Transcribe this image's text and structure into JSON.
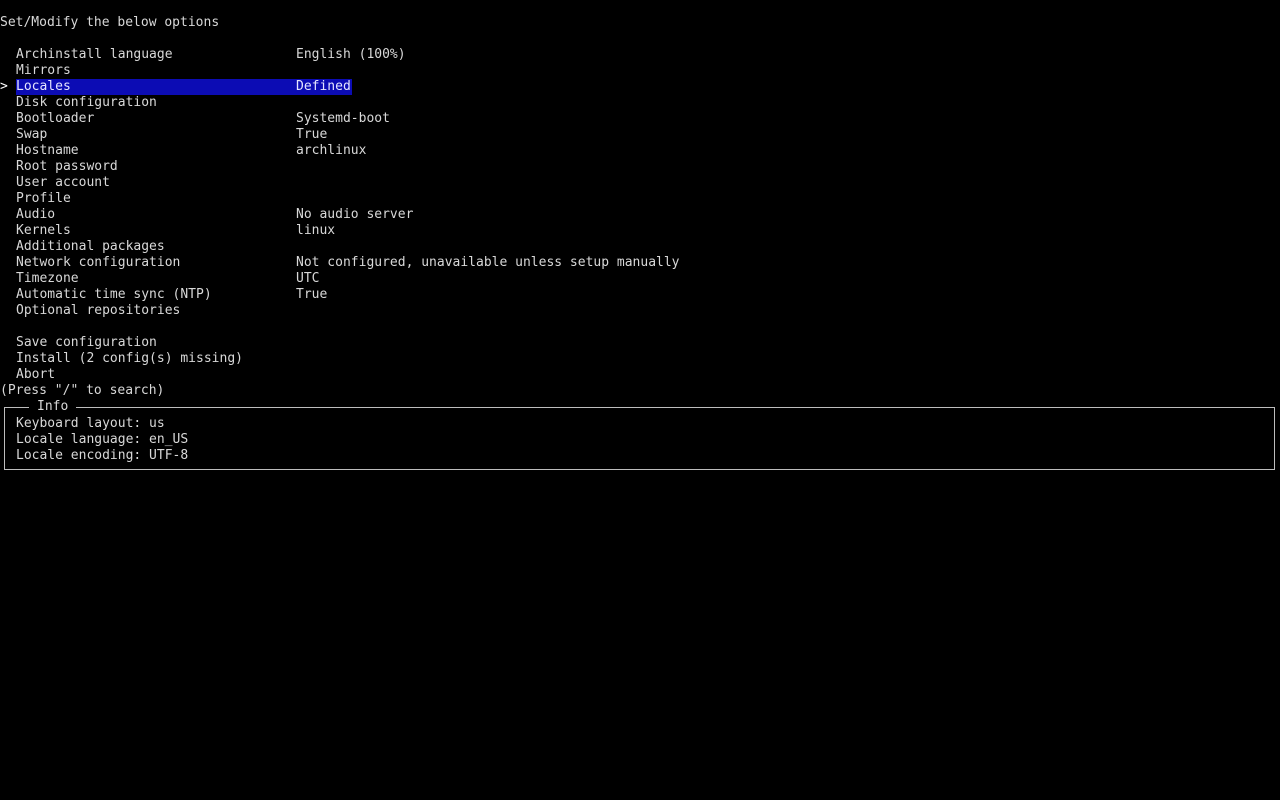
{
  "header": "Set/Modify the below options",
  "cursor_symbol": ">",
  "selected_index": 2,
  "menu": [
    {
      "label": "Archinstall language",
      "value": "English (100%)"
    },
    {
      "label": "Mirrors",
      "value": ""
    },
    {
      "label": "Locales",
      "value": "Defined"
    },
    {
      "label": "Disk configuration",
      "value": ""
    },
    {
      "label": "Bootloader",
      "value": "Systemd-boot"
    },
    {
      "label": "Swap",
      "value": "True"
    },
    {
      "label": "Hostname",
      "value": "archlinux"
    },
    {
      "label": "Root password",
      "value": ""
    },
    {
      "label": "User account",
      "value": ""
    },
    {
      "label": "Profile",
      "value": ""
    },
    {
      "label": "Audio",
      "value": "No audio server"
    },
    {
      "label": "Kernels",
      "value": "linux"
    },
    {
      "label": "Additional packages",
      "value": ""
    },
    {
      "label": "Network configuration",
      "value": "Not configured, unavailable unless setup manually"
    },
    {
      "label": "Timezone",
      "value": "UTC"
    },
    {
      "label": "Automatic time sync (NTP)",
      "value": "True"
    },
    {
      "label": "Optional repositories",
      "value": ""
    }
  ],
  "actions": [
    {
      "label": "Save configuration"
    },
    {
      "label": "Install (2 config(s) missing)"
    },
    {
      "label": "Abort"
    }
  ],
  "search_hint": "(Press \"/\" to search)",
  "info": {
    "title": "Info",
    "lines": [
      "Keyboard layout: us",
      "Locale language: en_US",
      "Locale encoding: UTF-8"
    ]
  },
  "colors": {
    "background": "#000000",
    "text": "#d8d8d8",
    "highlight": "#0c0cb4"
  }
}
